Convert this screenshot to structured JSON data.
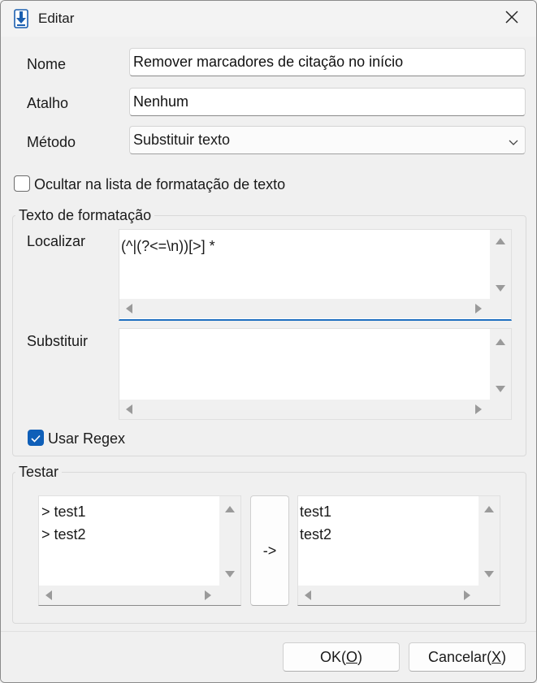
{
  "window": {
    "title": "Editar",
    "icon": "download-arrow-icon",
    "close_icon": "close-icon"
  },
  "form": {
    "nome_label": "Nome",
    "nome_value": "Remover marcadores de citação no início",
    "atalho_label": "Atalho",
    "atalho_value": "Nenhum",
    "metodo_label": "Método",
    "metodo_value": "Substituir texto",
    "hide_checkbox_label": "Ocultar na lista de formatação de texto",
    "hide_checked": false
  },
  "formatting": {
    "group_title": "Texto de formatação",
    "localizar_label": "Localizar",
    "localizar_value": "(^|(?<=\\n))[>] *",
    "substituir_label": "Substituir",
    "substituir_value": "",
    "regex_label": "Usar Regex",
    "regex_checked": true
  },
  "test": {
    "group_title": "Testar",
    "input_text": "> test1\n> test2",
    "convert_button": "->",
    "output_text": "test1\ntest2"
  },
  "buttons": {
    "ok_prefix": "OK(",
    "ok_key": "O",
    "ok_suffix": ")",
    "cancel_prefix": "Cancelar(",
    "cancel_key": "X",
    "cancel_suffix": ")"
  },
  "colors": {
    "accent": "#0f5fb8",
    "focus_underline": "#1f6fc0"
  }
}
